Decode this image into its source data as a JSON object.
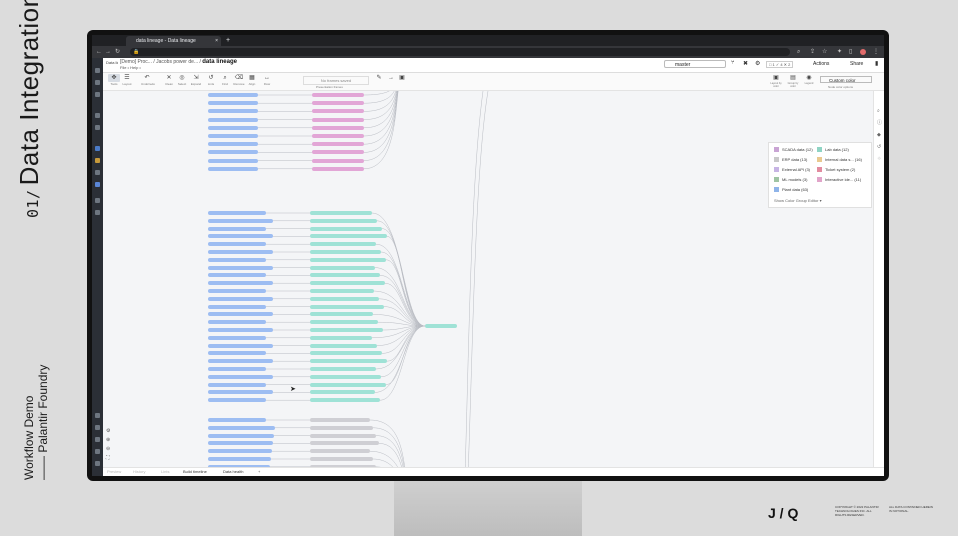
{
  "slide": {
    "number": "01/",
    "title": "Data Integration",
    "sub_line1": "Workflow Demo",
    "sub_line2": "—— Palantir Foundry",
    "logo_text": "J / Q",
    "copyright": "COPYRIGHT © 2022 PALANTIR TECHNOLOGIES INC. ALL RIGHTS RESERVED.",
    "rights": "ALL DATA CONTAINED HEREIN IS NOTIONAL."
  },
  "browser": {
    "tab_title": "data lineage - Data lineage",
    "tab_close": "×",
    "new_tab": "+",
    "icons": {
      "back": "←",
      "forward": "→",
      "reload": "↻",
      "lock": "🔒"
    }
  },
  "app": {
    "logo": "Data lineage",
    "breadcrumb_parts": [
      "[Demo] Proc...",
      "Jacobs power de...",
      "data lineage"
    ],
    "menus": "File •  Help •",
    "branch": "master",
    "checks": "□ 1  ✓ 4  ✕ 2",
    "actions_label": "Actions",
    "share_label": "Share",
    "toolbar": [
      {
        "icon": "✥",
        "label": "Tools"
      },
      {
        "icon": "☰",
        "label": "Layout"
      },
      {
        "icon": "↶",
        "label": "Undo/redo"
      },
      {
        "icon": "✕",
        "label": "Clean"
      },
      {
        "icon": "◎",
        "label": "Select"
      },
      {
        "icon": "⇲",
        "label": "Expand"
      },
      {
        "icon": "↺",
        "label": "Lints"
      },
      {
        "icon": "⌕",
        "label": "Find"
      },
      {
        "icon": "⌫",
        "label": "Remove"
      },
      {
        "icon": "▦",
        "label": "Align"
      },
      {
        "icon": "↔",
        "label": "Flow"
      }
    ],
    "no_frame": "No frames saved",
    "previous_frames": "Presentation frames",
    "right_toolbar": [
      {
        "icon": "▣",
        "label": "Layout by color"
      },
      {
        "icon": "▤",
        "label": "Group by color"
      },
      {
        "icon": "◉",
        "label": "Legend"
      }
    ],
    "color_mode": "Custom color",
    "color_options_label": "Node color options",
    "legend": {
      "items": [
        {
          "label": "SCADA data (12)",
          "color": "#c9a4d4"
        },
        {
          "label": "Lab data (12)",
          "color": "#8fd4c4"
        },
        {
          "label": "ERP data (13)",
          "color": "#c9c9c9"
        },
        {
          "label": "Internal data s... (16)",
          "color": "#e9c98f"
        },
        {
          "label": "External API (3)",
          "color": "#c7b4e4"
        },
        {
          "label": "Ticket system (2)",
          "color": "#e28b9f"
        },
        {
          "label": "ML models (3)",
          "color": "#9fc4a3"
        },
        {
          "label": "Interactive ide... (11)",
          "color": "#e1a4c9"
        },
        {
          "label": "Plant data (63)",
          "color": "#8fb4e9"
        }
      ],
      "edit_label": "Show Color Group Editor ▾"
    },
    "bottom_tabs": [
      "Preview",
      "History",
      "Lints",
      "Build timeline",
      "Data health"
    ],
    "colors": {
      "blue": "#9dbdf2",
      "pink": "#e2a6d6",
      "teal": "#9fe2d6",
      "gray": "#cfcfd4",
      "edge": "#b9bcc3"
    }
  }
}
